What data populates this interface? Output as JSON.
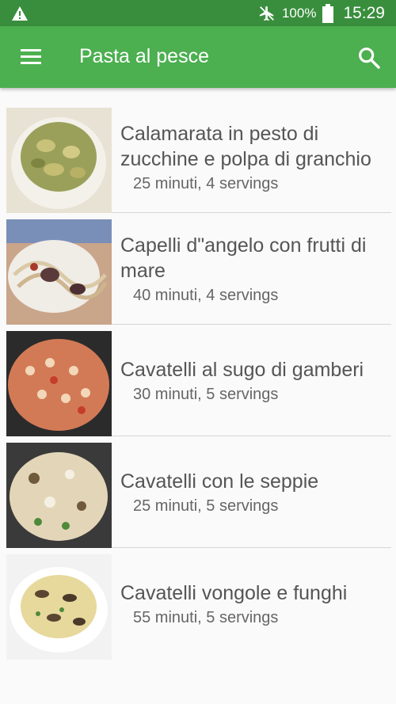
{
  "status_bar": {
    "battery_percent": "100%",
    "time": "15:29",
    "icons": [
      "warning-icon",
      "airplane-mode-icon",
      "battery-icon"
    ]
  },
  "app_bar": {
    "title": "Pasta al pesce",
    "icons": [
      "menu-icon",
      "search-icon"
    ]
  },
  "recipes": [
    {
      "name": "Calamarata in pesto di zucchine e polpa di granchio",
      "meta": "25 minuti, 4 servings"
    },
    {
      "name": "Capelli d\"angelo con frutti di mare",
      "meta": "40 minuti, 4 servings"
    },
    {
      "name": "Cavatelli al sugo di gamberi",
      "meta": "30 minuti, 5 servings"
    },
    {
      "name": "Cavatelli con le seppie",
      "meta": "25 minuti, 5 servings"
    },
    {
      "name": "Cavatelli vongole e funghi",
      "meta": "55 minuti, 5 servings"
    }
  ],
  "colors": {
    "status_bar": "#388e3c",
    "app_bar": "#4caf50",
    "background": "#fafafa"
  }
}
